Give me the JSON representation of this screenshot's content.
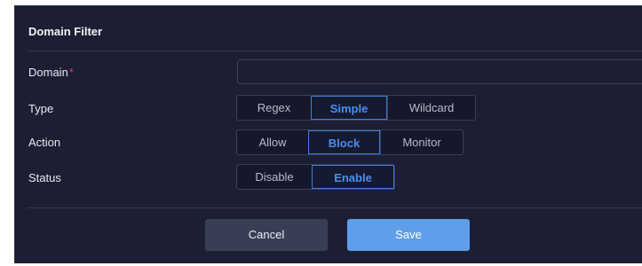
{
  "dialog": {
    "title": "Domain Filter"
  },
  "form": {
    "domain": {
      "label": "Domain",
      "required_mark": "*",
      "value": ""
    },
    "type": {
      "label": "Type",
      "options": [
        "Regex",
        "Simple",
        "Wildcard"
      ],
      "selected": "Simple"
    },
    "action": {
      "label": "Action",
      "options": [
        "Allow",
        "Block",
        "Monitor"
      ],
      "selected": "Block"
    },
    "status": {
      "label": "Status",
      "options": [
        "Disable",
        "Enable"
      ],
      "selected": "Enable"
    }
  },
  "buttons": {
    "cancel": "Cancel",
    "save": "Save"
  },
  "colors": {
    "background": "#1c1e33",
    "accent": "#4c8df0",
    "save_button": "#5f9ee8",
    "cancel_button": "#3a3e55",
    "required": "#e53e46"
  }
}
